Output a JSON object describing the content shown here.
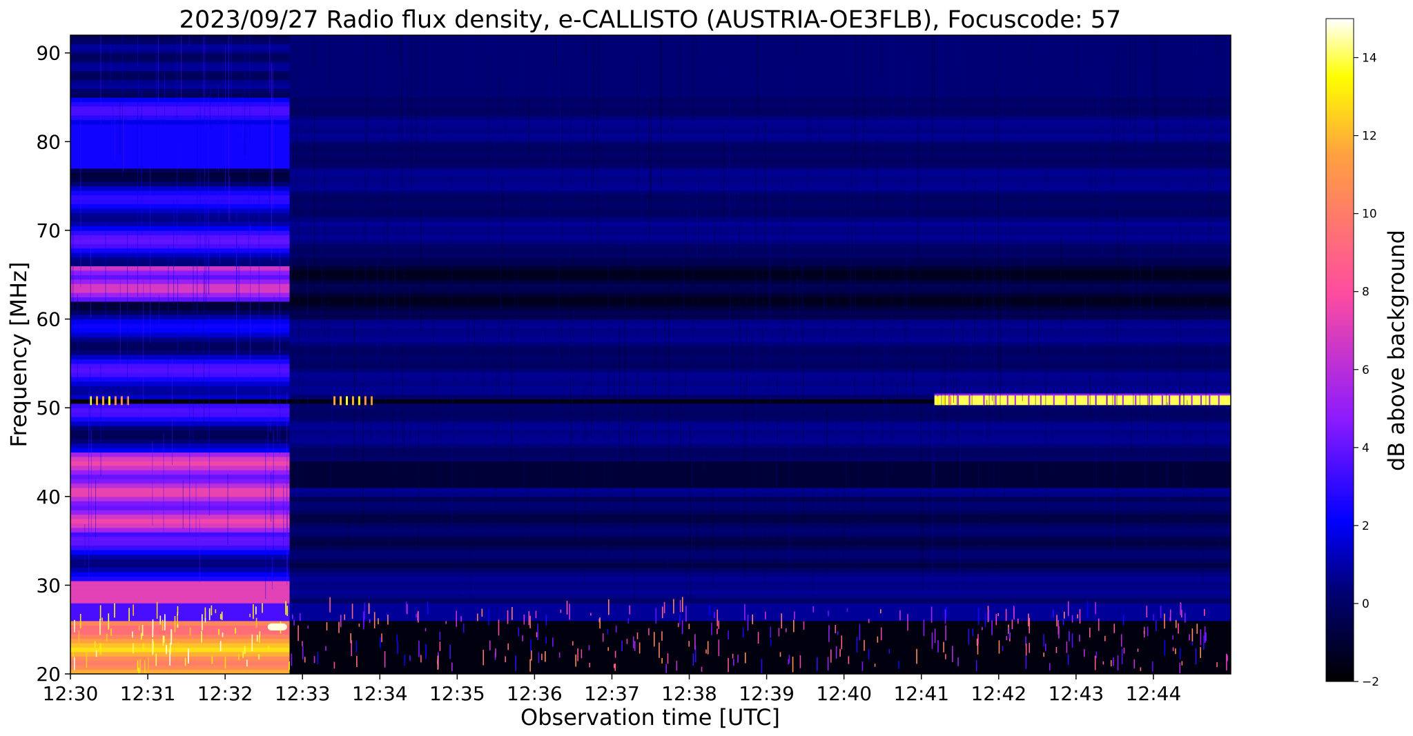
{
  "chart_data": {
    "type": "heatmap",
    "title": "2023/09/27  Radio flux density, e-CALLISTO (AUSTRIA-OE3FLB), Focuscode: 57",
    "xlabel": "Observation time [UTC]",
    "ylabel": "Frequency [MHz]",
    "x_ticks": [
      "12:30",
      "12:31",
      "12:32",
      "12:33",
      "12:34",
      "12:35",
      "12:36",
      "12:37",
      "12:38",
      "12:39",
      "12:40",
      "12:41",
      "12:42",
      "12:43",
      "12:44"
    ],
    "x_range_minutes_after_1230": [
      0,
      15
    ],
    "y_ticks": [
      20,
      30,
      40,
      50,
      60,
      70,
      80,
      90
    ],
    "ylim": [
      20,
      92
    ],
    "colorbar": {
      "label": "dB above background",
      "ticks": [
        -2,
        0,
        2,
        4,
        6,
        8,
        10,
        12,
        14
      ],
      "range": [
        -2,
        15
      ],
      "colormap": "gnuplot2",
      "stops": [
        {
          "value": -2,
          "color": "#000000"
        },
        {
          "value": 0.4,
          "color": "#00007a"
        },
        {
          "value": 2.1,
          "color": "#0000ff"
        },
        {
          "value": 4.7,
          "color": "#8a1aff"
        },
        {
          "value": 8.0,
          "color": "#ff4d9e"
        },
        {
          "value": 11.5,
          "color": "#ffa040"
        },
        {
          "value": 13.5,
          "color": "#ffff00"
        },
        {
          "value": 15,
          "color": "#ffffff"
        }
      ]
    },
    "features": [
      {
        "time_range": [
          "12:30",
          "12:32:50"
        ],
        "freq_range": [
          20,
          92
        ],
        "level_db": 2.5,
        "note": "elevated background segment"
      },
      {
        "time_range": [
          "12:30",
          "12:32:50"
        ],
        "freq_range": [
          20,
          26
        ],
        "level_db": 12,
        "note": "strong low-frequency emission"
      },
      {
        "time_range": [
          "12:41:10",
          "12:45"
        ],
        "freq_range": [
          50.3,
          51.4
        ],
        "level_db": 14,
        "note": "narrowband interference line"
      },
      {
        "time_range": [
          "12:32:50",
          "12:45"
        ],
        "freq_range": [
          20,
          28
        ],
        "level_db": 0,
        "note": "sporadic impulsive noise"
      }
    ]
  }
}
